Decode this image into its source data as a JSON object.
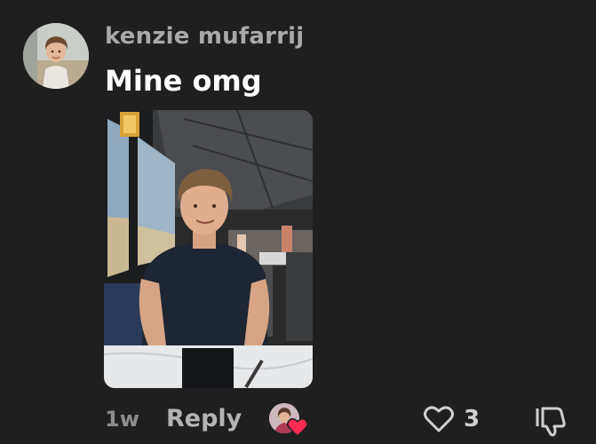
{
  "comment": {
    "username": "kenzie mufarrij",
    "text": "Mine omg",
    "avatar_icon": "user-avatar-photo",
    "attached_photo_icon": "comment-photo"
  },
  "footer": {
    "time": "1w",
    "reply_label": "Reply",
    "like_count": "3",
    "creator_liked": true,
    "icons": {
      "like": "heart-outline-icon",
      "dislike": "thumbs-down-icon",
      "creator_heart": "heart-filled-icon"
    }
  },
  "colors": {
    "background": "#1f1f1f",
    "username": "#a9a9a9",
    "text": "#ffffff",
    "muted": "#8e8e8e",
    "accent_heart": "#fe2c55"
  }
}
